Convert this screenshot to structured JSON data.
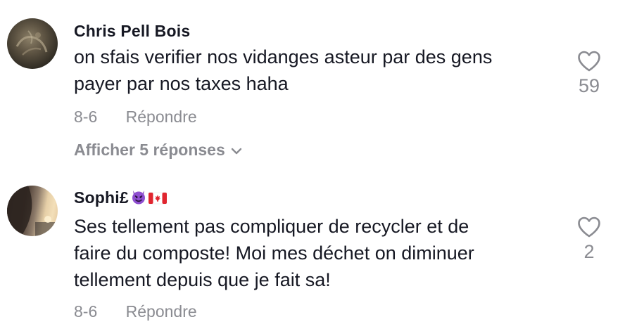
{
  "comments": [
    {
      "username": "Chris Pell Bois",
      "text": "on sfais verifier nos vidanges asteur par des gens\npayer par nos taxes haha",
      "date": "8-6",
      "reply_label": "Répondre",
      "like_count": "59",
      "show_replies_label": "Afficher 5 réponses",
      "avatar_icon": "rock-texture-avatar"
    },
    {
      "username": "Sophi£",
      "username_emojis": [
        "smiling-devil-emoji",
        "canada-flag-emoji"
      ],
      "text": "Ses tellement pas compliquer de recycler et de\nfaire du composte! Moi mes déchet on diminuer\ntellement depuis que je fait sa!",
      "date": "8-6",
      "reply_label": "Répondre",
      "like_count": "2",
      "avatar_icon": "sunset-portrait-avatar"
    }
  ],
  "colors": {
    "text_primary": "#161823",
    "text_secondary": "#8a8b91",
    "background": "#ffffff"
  }
}
